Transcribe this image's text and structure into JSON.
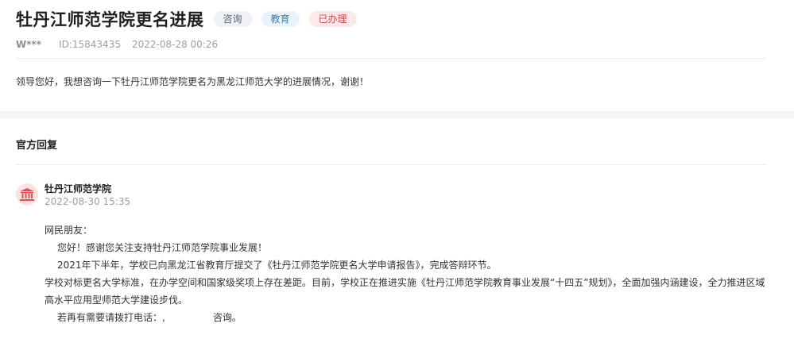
{
  "header": {
    "title": "牡丹江师范学院更名进展",
    "tags": [
      "咨询",
      "教育",
      "已办理"
    ],
    "user": "W***",
    "id_text": "ID:15843435",
    "time": "2022-08-28 00:26"
  },
  "question": "领导您好，我想咨询一下牡丹江师范学院更名为黑龙江师范大学的进展情况，谢谢！",
  "reply": {
    "section_title": "官方回复",
    "org_name": "牡丹江师范学院",
    "time": "2022-08-30 15:35",
    "org_icon": "building-icon",
    "greeting": "网民朋友：",
    "line1": "您好！感谢您关注支持牡丹江师范学院事业发展！",
    "line2": "2021年下半年，学校已向黑龙江省教育厅提交了《牡丹江师范学院更名大学申请报告》，完成答辩环节。",
    "line3": "学校对标更名大学标准，在办学空间和国家级奖项上存在差距。目前，学校正在推进实施《牡丹江师范学院教育事业发展“十四五”规划》，全面加强内涵建设，全力推进区域高水平应用型师范大学建设步伐。",
    "line4_prefix": "若再有需要请拨打电话：",
    "line4_mid": ",",
    "line4_suffix": "咨询。"
  }
}
